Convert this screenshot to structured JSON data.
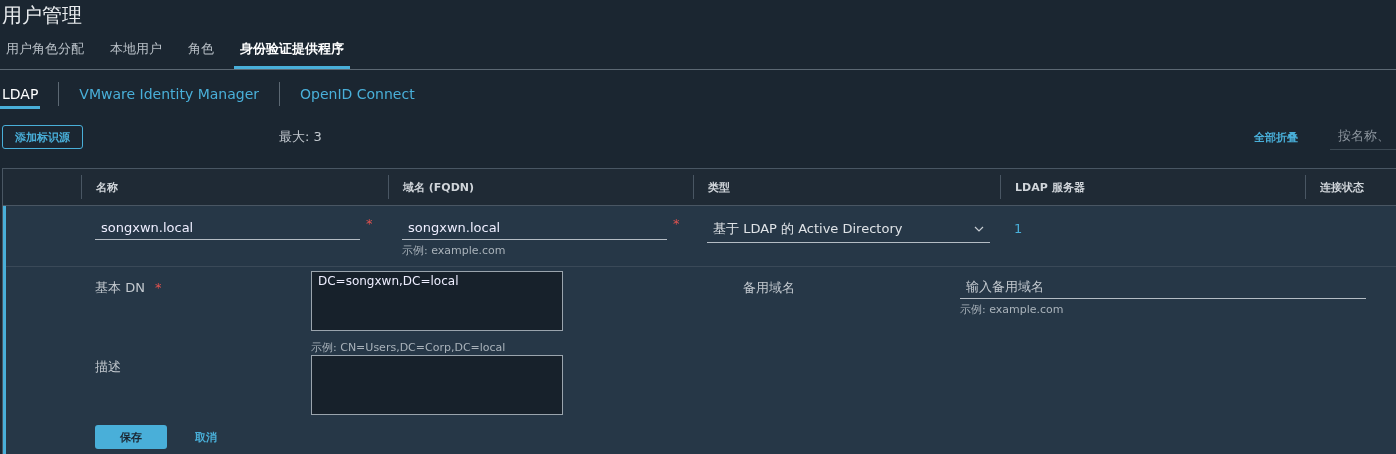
{
  "title": "用户管理",
  "tabs": [
    {
      "label": "用户角色分配",
      "selected": false
    },
    {
      "label": "本地用户",
      "selected": false
    },
    {
      "label": "角色",
      "selected": false
    },
    {
      "label": "身份验证提供程序",
      "selected": true
    }
  ],
  "subtabs": [
    {
      "label": "LDAP",
      "selected": true
    },
    {
      "label": "VMware Identity Manager",
      "selected": false
    },
    {
      "label": "OpenID Connect",
      "selected": false
    }
  ],
  "toolbar": {
    "add_button": "添加标识源",
    "max": "最大: 3",
    "collapse_all": "全部折叠",
    "search": {
      "placeholder": "按名称、"
    }
  },
  "table": {
    "columns": [
      "名称",
      "域名 (FQDN)",
      "类型",
      "LDAP 服务器",
      "连接状态"
    ],
    "row": {
      "expanded": true,
      "name": {
        "value": "songxwn.local",
        "required": "*"
      },
      "domain": {
        "value": "songxwn.local",
        "required": "*",
        "hint": "示例: example.com"
      },
      "type": "基于 LDAP 的 Active Directory",
      "servers": "1",
      "detail": {
        "base_dn": {
          "label": "基本 DN",
          "required": "*",
          "value": "DC=songxwn,DC=local",
          "hint": "示例: CN=Users,DC=Corp,DC=local"
        },
        "description": {
          "label": "描述"
        },
        "alt_domain": {
          "label": "备用域名",
          "placeholder": "输入备用域名",
          "hint": "示例: example.com"
        },
        "save": "保存",
        "cancel": "取消"
      }
    }
  }
}
